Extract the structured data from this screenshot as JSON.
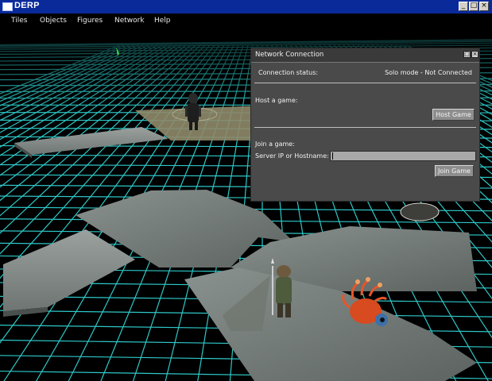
{
  "window": {
    "title": "DERP",
    "minimize": "_",
    "maximize": "□",
    "close": "×"
  },
  "menu": [
    "Tiles",
    "Objects",
    "Figures",
    "Network",
    "Help"
  ],
  "dialog": {
    "title": "Network Connection",
    "connection_label": "Connection status:",
    "connection_value": "Solo mode - Not Connected",
    "host_label": "Host a game:",
    "host_button": "Host Game",
    "join_label": "Join a game:",
    "server_label": "Server IP or Hostname:",
    "server_value": "",
    "join_button": "Join Game"
  },
  "colors": {
    "grid": "#2ec8c8",
    "titlebar": "#0a2a9a",
    "panel": "#4a4a4a"
  }
}
